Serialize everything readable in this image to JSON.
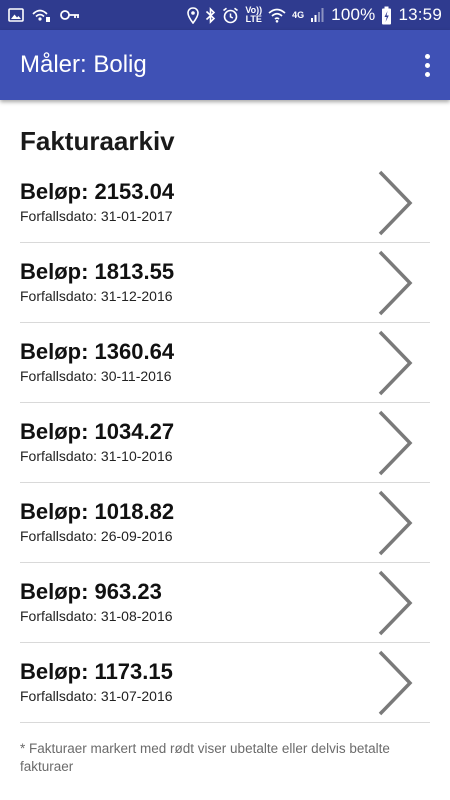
{
  "status_bar": {
    "time": "13:59",
    "battery": "100%",
    "volte_top": "Vo))",
    "volte_bottom": "LTE",
    "network": "4G",
    "icons_left": [
      "image-icon",
      "wifi-calling-icon",
      "key-icon"
    ],
    "icons_right": [
      "location-icon",
      "bluetooth-icon",
      "alarm-icon",
      "volte-icon",
      "wifi-icon",
      "signal-icon",
      "battery-charging-icon"
    ]
  },
  "app_bar": {
    "title": "Måler: Bolig",
    "menu_icon": "more-vert-icon"
  },
  "main": {
    "section_title": "Fakturaarkiv",
    "invoices": [
      {
        "amount": "Beløp: 2153.04",
        "due": "Forfallsdato: 31-01-2017"
      },
      {
        "amount": "Beløp: 1813.55",
        "due": "Forfallsdato: 31-12-2016"
      },
      {
        "amount": "Beløp: 1360.64",
        "due": "Forfallsdato: 30-11-2016"
      },
      {
        "amount": "Beløp: 1034.27",
        "due": "Forfallsdato: 31-10-2016"
      },
      {
        "amount": "Beløp: 1018.82",
        "due": "Forfallsdato: 26-09-2016"
      },
      {
        "amount": "Beløp: 963.23",
        "due": "Forfallsdato: 31-08-2016"
      },
      {
        "amount": "Beløp: 1173.15",
        "due": "Forfallsdato: 31-07-2016"
      }
    ],
    "footnote": "* Fakturaer markert med rødt viser ubetalte eller delvis betalte fakturaer"
  },
  "colors": {
    "status_bar": "#2f3b8f",
    "app_bar": "#3f51b5",
    "chevron": "#7a7a7a",
    "divider": "#d9d9d9",
    "footnote": "#6b6b6b"
  }
}
